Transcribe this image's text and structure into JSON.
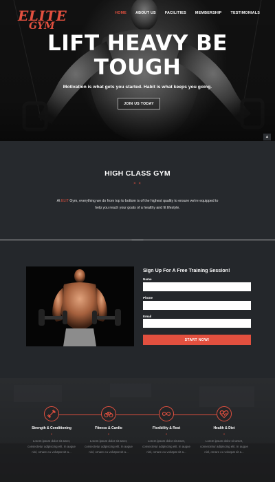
{
  "logo": {
    "line1": "ELITE",
    "line2": "GYM"
  },
  "nav": {
    "items": [
      {
        "label": "HOME",
        "active": true
      },
      {
        "label": "ABOUT US",
        "active": false
      },
      {
        "label": "FACILITIES",
        "active": false
      },
      {
        "label": "MEMBERSHIP",
        "active": false
      },
      {
        "label": "TESTIMONIALS",
        "active": false
      }
    ]
  },
  "hero": {
    "title_line1": "LIFT HEAVY BE",
    "title_line2": "TOUGH",
    "subtitle": "Motivation is what gets you started. Habit is what keeps you going.",
    "button": "JOIN US TODAY",
    "scroll_top_icon": "caret-up-icon"
  },
  "about": {
    "title": "HIGH CLASS GYM",
    "separator": "× ×",
    "text_before": "At ",
    "text_accent": "ELIT",
    "text_after": " Gym, everything we do from top to bottom is of the highest quality to ensure we're equipped to help you reach your goals of a healthy and fit lifestyle."
  },
  "signup": {
    "title": "Sign Up For A Free Training Session!",
    "fields": [
      {
        "label": "Name",
        "value": "",
        "placeholder": ""
      },
      {
        "label": "Phone",
        "value": "",
        "placeholder": ""
      },
      {
        "label": "Email",
        "value": "",
        "placeholder": ""
      }
    ],
    "button": "START NOW!"
  },
  "features": [
    {
      "icon": "dumbbell-icon",
      "title": "Strength & Conditioning",
      "mark": "×",
      "desc": [
        "Lorem ipsum dolor sit amet,",
        "consectetur adipiscing elit. In augue",
        "nisl, ornare eu volutpat sit a..."
      ]
    },
    {
      "icon": "bicycle-icon",
      "title": "Fitness & Cardio",
      "mark": "×",
      "desc": [
        "Lorem ipsum dolor sit amet,",
        "consectetur adipiscing elit. In augue",
        "nisl, ornare eu volutpat sit a..."
      ]
    },
    {
      "icon": "infinity-icon",
      "title": "Flexibility & Rest",
      "mark": "×",
      "desc": [
        "Lorem ipsum dolor sit amet,",
        "consectetur adipiscing elit. In augue",
        "nisl, ornare eu volutpat sit a..."
      ]
    },
    {
      "icon": "heartbeat-icon",
      "title": "Health & Diet",
      "mark": "×",
      "desc": [
        "Lorem ipsum dolor sit amet,",
        "consectetur adipiscing elit. In augue",
        "nisl, ornare eu volutpat sit a..."
      ]
    }
  ],
  "colors": {
    "accent": "#e2503f",
    "background": "#1f2124",
    "panel": "#26292d"
  }
}
